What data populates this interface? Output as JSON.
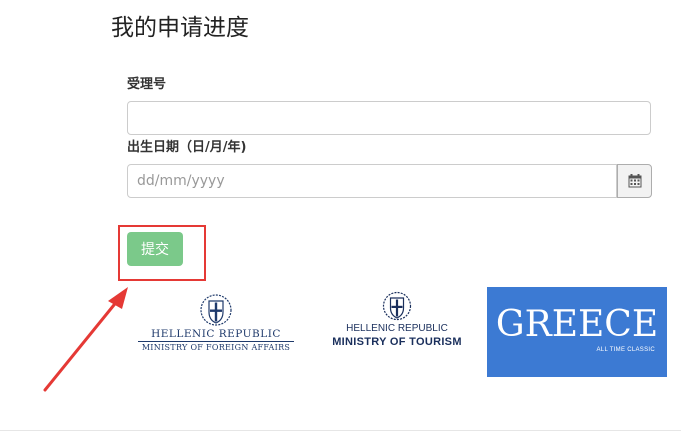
{
  "page": {
    "title": "我的申请进度"
  },
  "form": {
    "reference_label": "受理号",
    "reference_value": "",
    "dob_label": "出生日期（日/月/年)",
    "dob_placeholder": "dd/mm/yyyy",
    "dob_value": "",
    "calendar_icon": "calendar-icon",
    "submit_label": "提交"
  },
  "logos": {
    "mfa": {
      "line1": "HELLENIC REPUBLIC",
      "line2": "MINISTRY OF FOREIGN AFFAIRS"
    },
    "tourism": {
      "line1": "HELLENIC REPUBLIC",
      "line2": "MINISTRY OF TOURISM"
    },
    "greece": {
      "word": "GREECE",
      "tagline": "ALL TIME CLASSIC"
    }
  },
  "colors": {
    "submit_button": "#7bc98a",
    "highlight": "#e53935",
    "greece_brand": "#3c7ad3",
    "ministry_blue": "#1f3a6b"
  }
}
